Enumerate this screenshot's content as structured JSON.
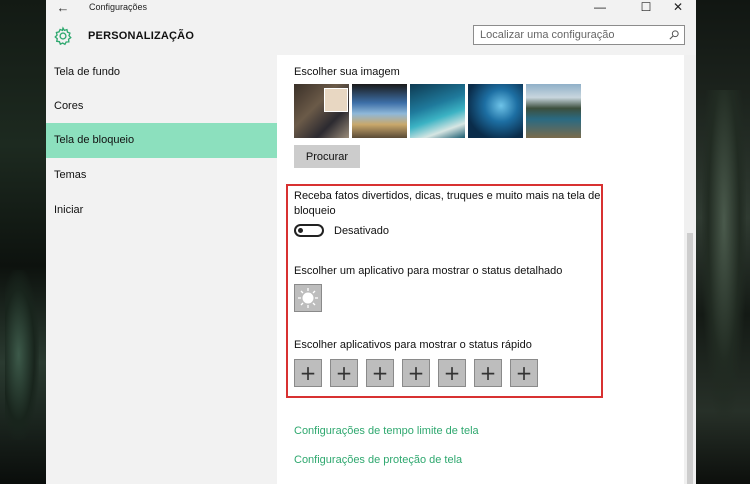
{
  "window": {
    "title": "Configurações",
    "back_icon": "←",
    "controls": {
      "minimize": "—",
      "maximize": "☐",
      "close": "✕"
    }
  },
  "header": {
    "title": "PERSONALIZAÇÃO",
    "icon": "gear-icon",
    "search_placeholder": "Localizar uma configuração"
  },
  "sidebar": {
    "items": [
      {
        "label": "Tela de fundo"
      },
      {
        "label": "Cores"
      },
      {
        "label": "Tela de bloqueio",
        "active": true
      },
      {
        "label": "Temas"
      },
      {
        "label": "Iniciar"
      }
    ]
  },
  "content": {
    "choose_image_label": "Escolher sua imagem",
    "browse_label": "Procurar",
    "fun_facts_text": "Receba fatos divertidos, dicas, truques e muito mais na tela de bloqueio",
    "toggle_state_label": "Desativado",
    "toggle_on": false,
    "detail_app_label": "Escolher um aplicativo para mostrar o status detalhado",
    "detail_app_icon": "sun-icon",
    "quick_apps_label": "Escolher aplicativos para mostrar o status rápido",
    "quick_app_symbol": "+",
    "links": {
      "screen_timeout": "Configurações de tempo limite de tela",
      "screen_saver": "Configurações de proteção de tela"
    }
  },
  "colors": {
    "accent": "#2fa86f",
    "active_nav": "#8ce0be",
    "highlight_border": "#d83131"
  }
}
